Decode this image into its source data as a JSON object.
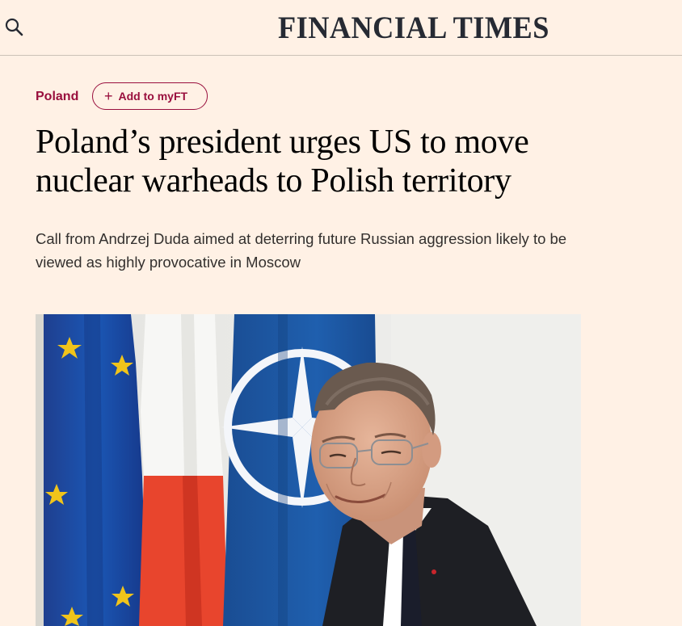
{
  "header": {
    "masthead": "FINANCIAL TIMES",
    "search_icon": "search-icon"
  },
  "article": {
    "topic": "Poland",
    "myft_button": {
      "icon": "plus-icon",
      "label": "Add to myFT"
    },
    "headline": "Poland’s president urges US to move nuclear warheads to Polish territory",
    "standfirst": "Call from Andrzej Duda aimed at deterring future Russian aggression likely to be viewed as highly provocative in Moscow"
  },
  "colors": {
    "background": "#fff1e5",
    "accent": "#990f3d",
    "headline": "#000000",
    "body_text": "#33302e"
  }
}
